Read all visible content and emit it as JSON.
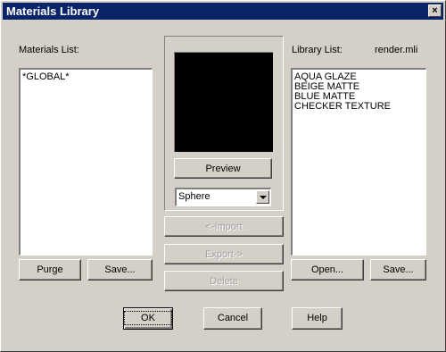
{
  "window": {
    "title": "Materials Library",
    "close_glyph": "×"
  },
  "materials": {
    "label": "Materials List:",
    "items": [
      "*GLOBAL*"
    ],
    "purge_label": "Purge",
    "save_label": "Save..."
  },
  "preview": {
    "preview_label": "Preview",
    "shape_value": "Sphere",
    "import_label": "<-Import",
    "export_label": "Export->",
    "delete_label": "Delete"
  },
  "library": {
    "label": "Library List:",
    "filename": "render.mli",
    "items": [
      "AQUA GLAZE",
      "BEIGE MATTE",
      "BLUE MATTE",
      "CHECKER TEXTURE"
    ],
    "open_label": "Open...",
    "save_label": "Save..."
  },
  "footer": {
    "ok_label": "OK",
    "cancel_label": "Cancel",
    "help_label": "Help"
  },
  "colors": {
    "titlebar": "#0a246a",
    "face": "#d4d0c8",
    "preview_bg": "#000000"
  }
}
